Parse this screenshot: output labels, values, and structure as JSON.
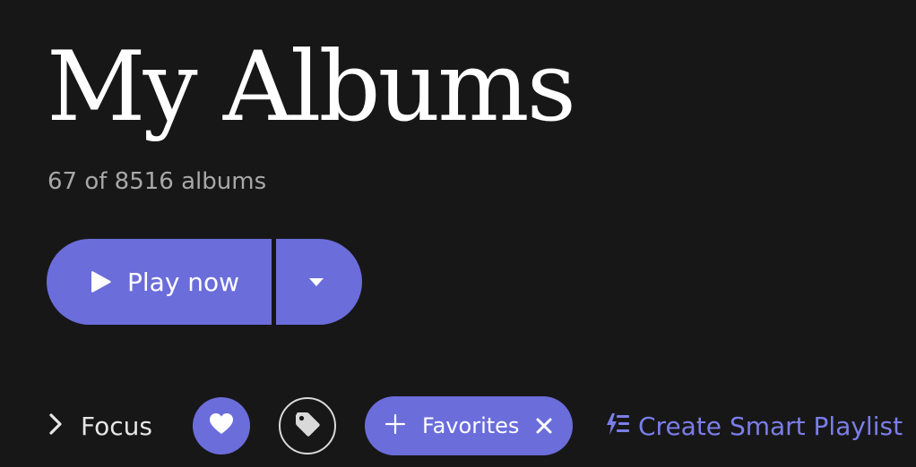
{
  "header": {
    "title": "My Albums",
    "subtitle": "67 of 8516 albums"
  },
  "actions": {
    "play_label": "Play now",
    "play_icon": "play-icon",
    "dropdown_icon": "caret-down-icon"
  },
  "filters": {
    "focus_label": "Focus",
    "focus_icon": "chevron-right-icon",
    "heart_icon": "heart-icon",
    "tag_icon": "tag-icon",
    "chip": {
      "label": "Favorites",
      "add_icon": "plus-icon",
      "remove_icon": "close-icon"
    },
    "smart_playlist_label": "Create Smart Playlist",
    "smart_playlist_icon": "smart-playlist-icon"
  },
  "colors": {
    "background": "#181718",
    "accent": "#6b6ddb",
    "link": "#7b7ee8",
    "muted_text": "#a8a8a8"
  }
}
